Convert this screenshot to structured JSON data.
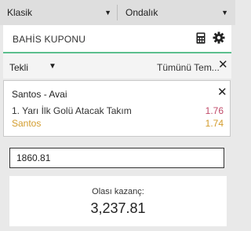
{
  "selectors": {
    "left": {
      "value": "Klasik",
      "icon": "dropdown-arrow"
    },
    "right": {
      "value": "Ondalık",
      "icon": "dropdown-arrow"
    }
  },
  "coupon": {
    "title": "BAHİS KUPONU",
    "icons": [
      "calculator-icon",
      "gear-icon"
    ],
    "accent_color": "#5cbf8e"
  },
  "bet_type": {
    "value": "Tekli",
    "remove_all_label": "Tümünü Tem..."
  },
  "bet": {
    "match": "Santos - Avai",
    "market": "1. Yarı İlk Golü Atacak Takım",
    "market_odds": "1.76",
    "selection": "Santos",
    "selection_odds": "1.74",
    "colors": {
      "market_odds": "#c14b6a",
      "selection": "#d39c2c"
    }
  },
  "stake": {
    "value": "1860.81"
  },
  "potential_win": {
    "label": "Olası kazanç:",
    "value": "3,237.81"
  }
}
